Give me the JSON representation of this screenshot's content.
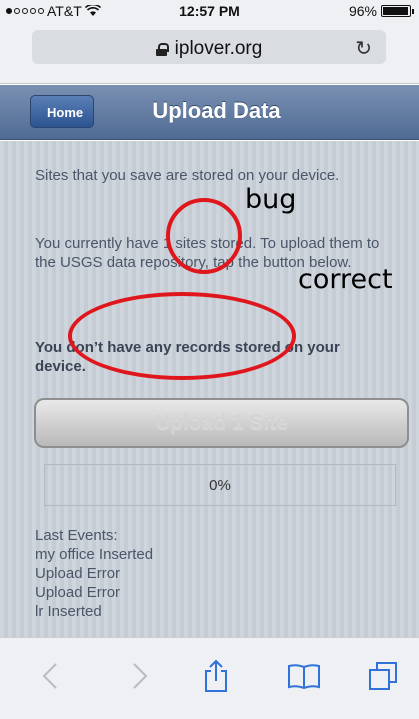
{
  "status_bar": {
    "carrier": "AT&T",
    "time": "12:57 PM",
    "battery": "96%",
    "battery_level": 0.96,
    "signal_bars": 1
  },
  "browser": {
    "url": "iplover.org"
  },
  "nav": {
    "back_label": "Home",
    "title": "Upload Data"
  },
  "main": {
    "paragraph1": "Sites that you save are stored on your device.",
    "paragraph2": "You currently have 1 sites stored. To upload them to the USGS data repository, tap the button below.",
    "paragraph3": "You don’t have any records stored on your device.",
    "upload_button": "Upload 1 Site",
    "progress": {
      "label": "0%",
      "value": 0
    },
    "events_title": "Last Events:",
    "events": [
      "my office Inserted",
      "Upload Error",
      "Upload Error",
      "lr Inserted"
    ]
  },
  "annotations": {
    "bug": "bug",
    "correct": "correct",
    "color": "#e0161d"
  },
  "toolbar": {
    "icons": [
      "back-icon",
      "forward-icon",
      "share-icon",
      "bookmarks-icon",
      "tabs-icon"
    ]
  }
}
